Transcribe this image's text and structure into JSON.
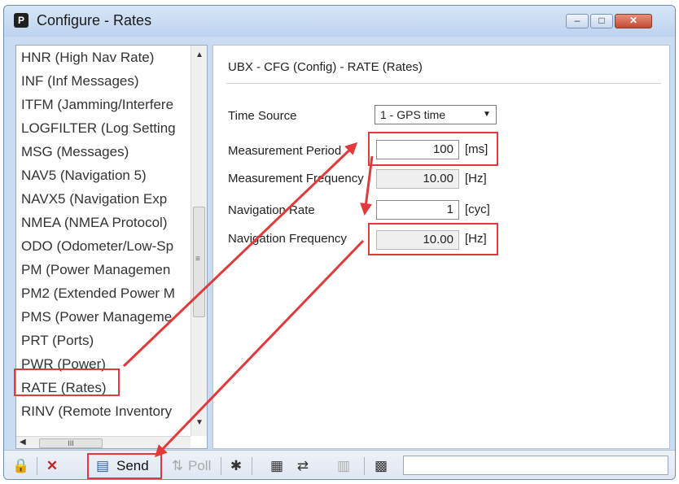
{
  "window": {
    "title": "Configure - Rates",
    "app_icon": "P"
  },
  "list": {
    "items": [
      "HNR (High Nav Rate)",
      "INF (Inf Messages)",
      "ITFM (Jamming/Interfere",
      "LOGFILTER (Log Setting",
      "MSG (Messages)",
      "NAV5 (Navigation 5)",
      "NAVX5 (Navigation Exp",
      "NMEA (NMEA Protocol)",
      "ODO (Odometer/Low-Sp",
      "PM (Power Managemen",
      "PM2 (Extended Power M",
      "PMS (Power Manageme",
      "PRT (Ports)",
      "PWR (Power)",
      "RATE (Rates)",
      "RINV (Remote Inventory"
    ],
    "selected": "RATE (Rates)"
  },
  "panel": {
    "header": "UBX - CFG (Config) - RATE (Rates)",
    "time_source": {
      "label": "Time Source",
      "value": "1 - GPS time"
    },
    "measurement_period": {
      "label": "Measurement Period",
      "value": "100",
      "unit": "[ms]"
    },
    "measurement_frequency": {
      "label": "Measurement Frequency",
      "value": "10.00",
      "unit": "[Hz]"
    },
    "navigation_rate": {
      "label": "Navigation Rate",
      "value": "1",
      "unit": "[cyc]"
    },
    "navigation_frequency": {
      "label": "Navigation Frequency",
      "value": "10.00",
      "unit": "[Hz]"
    }
  },
  "toolbar": {
    "send_label": "Send",
    "poll_label": "Poll"
  },
  "colors": {
    "highlight": "#e23a3a",
    "title_bar": "#c9dcf1"
  }
}
